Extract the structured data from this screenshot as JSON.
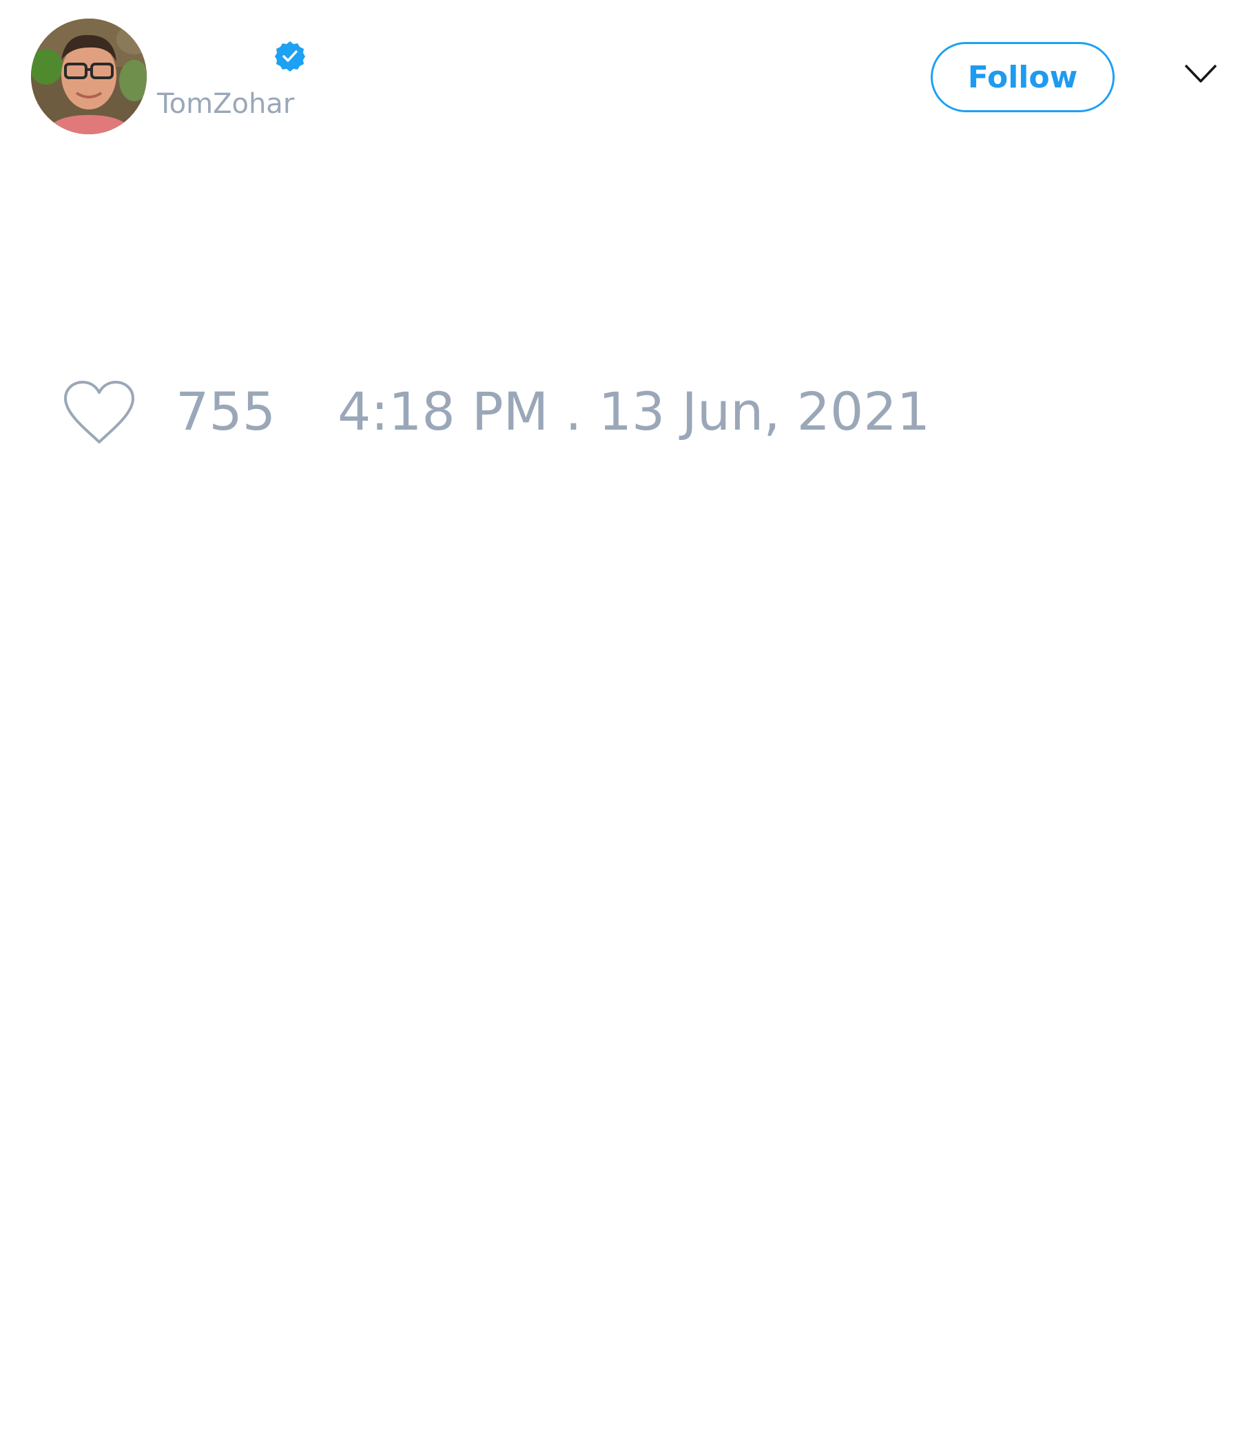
{
  "tweet": {
    "author": {
      "display_name": "",
      "handle": "TomZohar",
      "verified": true,
      "avatar_icon": "profile-photo"
    },
    "follow_label": "Follow",
    "menu_icon": "chevron-down-icon",
    "like_icon": "heart-outline-icon",
    "like_count": "755",
    "timestamp": "4:18 PM . 13 Jun, 2021"
  },
  "colors": {
    "accent": "#1da1f2",
    "muted_text": "#9aa7b8",
    "background": "#ffffff"
  }
}
